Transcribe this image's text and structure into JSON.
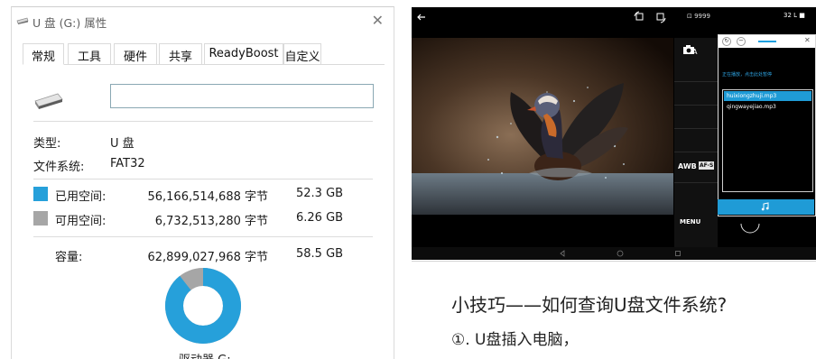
{
  "dialog": {
    "title": "U 盘 (G:) 属性",
    "close_glyph": "✕",
    "tabs": [
      "常规",
      "工具",
      "硬件",
      "共享",
      "ReadyBoost",
      "自定义"
    ],
    "active_tab": "常规",
    "name_field_value": "",
    "type_label": "类型:",
    "type_value": "U 盘",
    "fs_label": "文件系统:",
    "fs_value": "FAT32",
    "used_label": "已用空间:",
    "used_bytes": "56,166,514,688 字节",
    "used_size": "52.3 GB",
    "free_label": "可用空间:",
    "free_bytes": "6,732,513,280 字节",
    "free_size": "6.26 GB",
    "capacity_label": "容量:",
    "capacity_bytes": "62,899,027,968 字节",
    "capacity_size": "58.5 GB",
    "drive_label": "驱动器 G:",
    "used_fraction": 0.893,
    "colors": {
      "used": "#26a0da",
      "free": "#a6a6a6"
    },
    "icons": [
      "usb-drive-icon",
      "close-icon"
    ]
  },
  "phone": {
    "status_left": "⊡ 9999",
    "status_right": "32 L ■",
    "camera_a": "A",
    "awb_label": "AWB",
    "af_badge": "AF-S",
    "menu_label": "MENU",
    "popup": {
      "play_hint": "正在播放，点击此处暂停",
      "tracks": [
        "huixiongzhuji.mp3",
        "qingwayejiao.mp3"
      ],
      "selected_track": 0
    },
    "icons": [
      "back-arrow-icon",
      "rotate-icon",
      "camera-icon",
      "music-note-icon",
      "nav-back-icon",
      "nav-home-icon",
      "nav-recent-icon"
    ],
    "colors": {
      "accent": "#1f9bd6"
    }
  },
  "tip": {
    "title": "小技巧——如何查询U盘文件系统?",
    "step1": "①. U盘插入电脑，"
  }
}
